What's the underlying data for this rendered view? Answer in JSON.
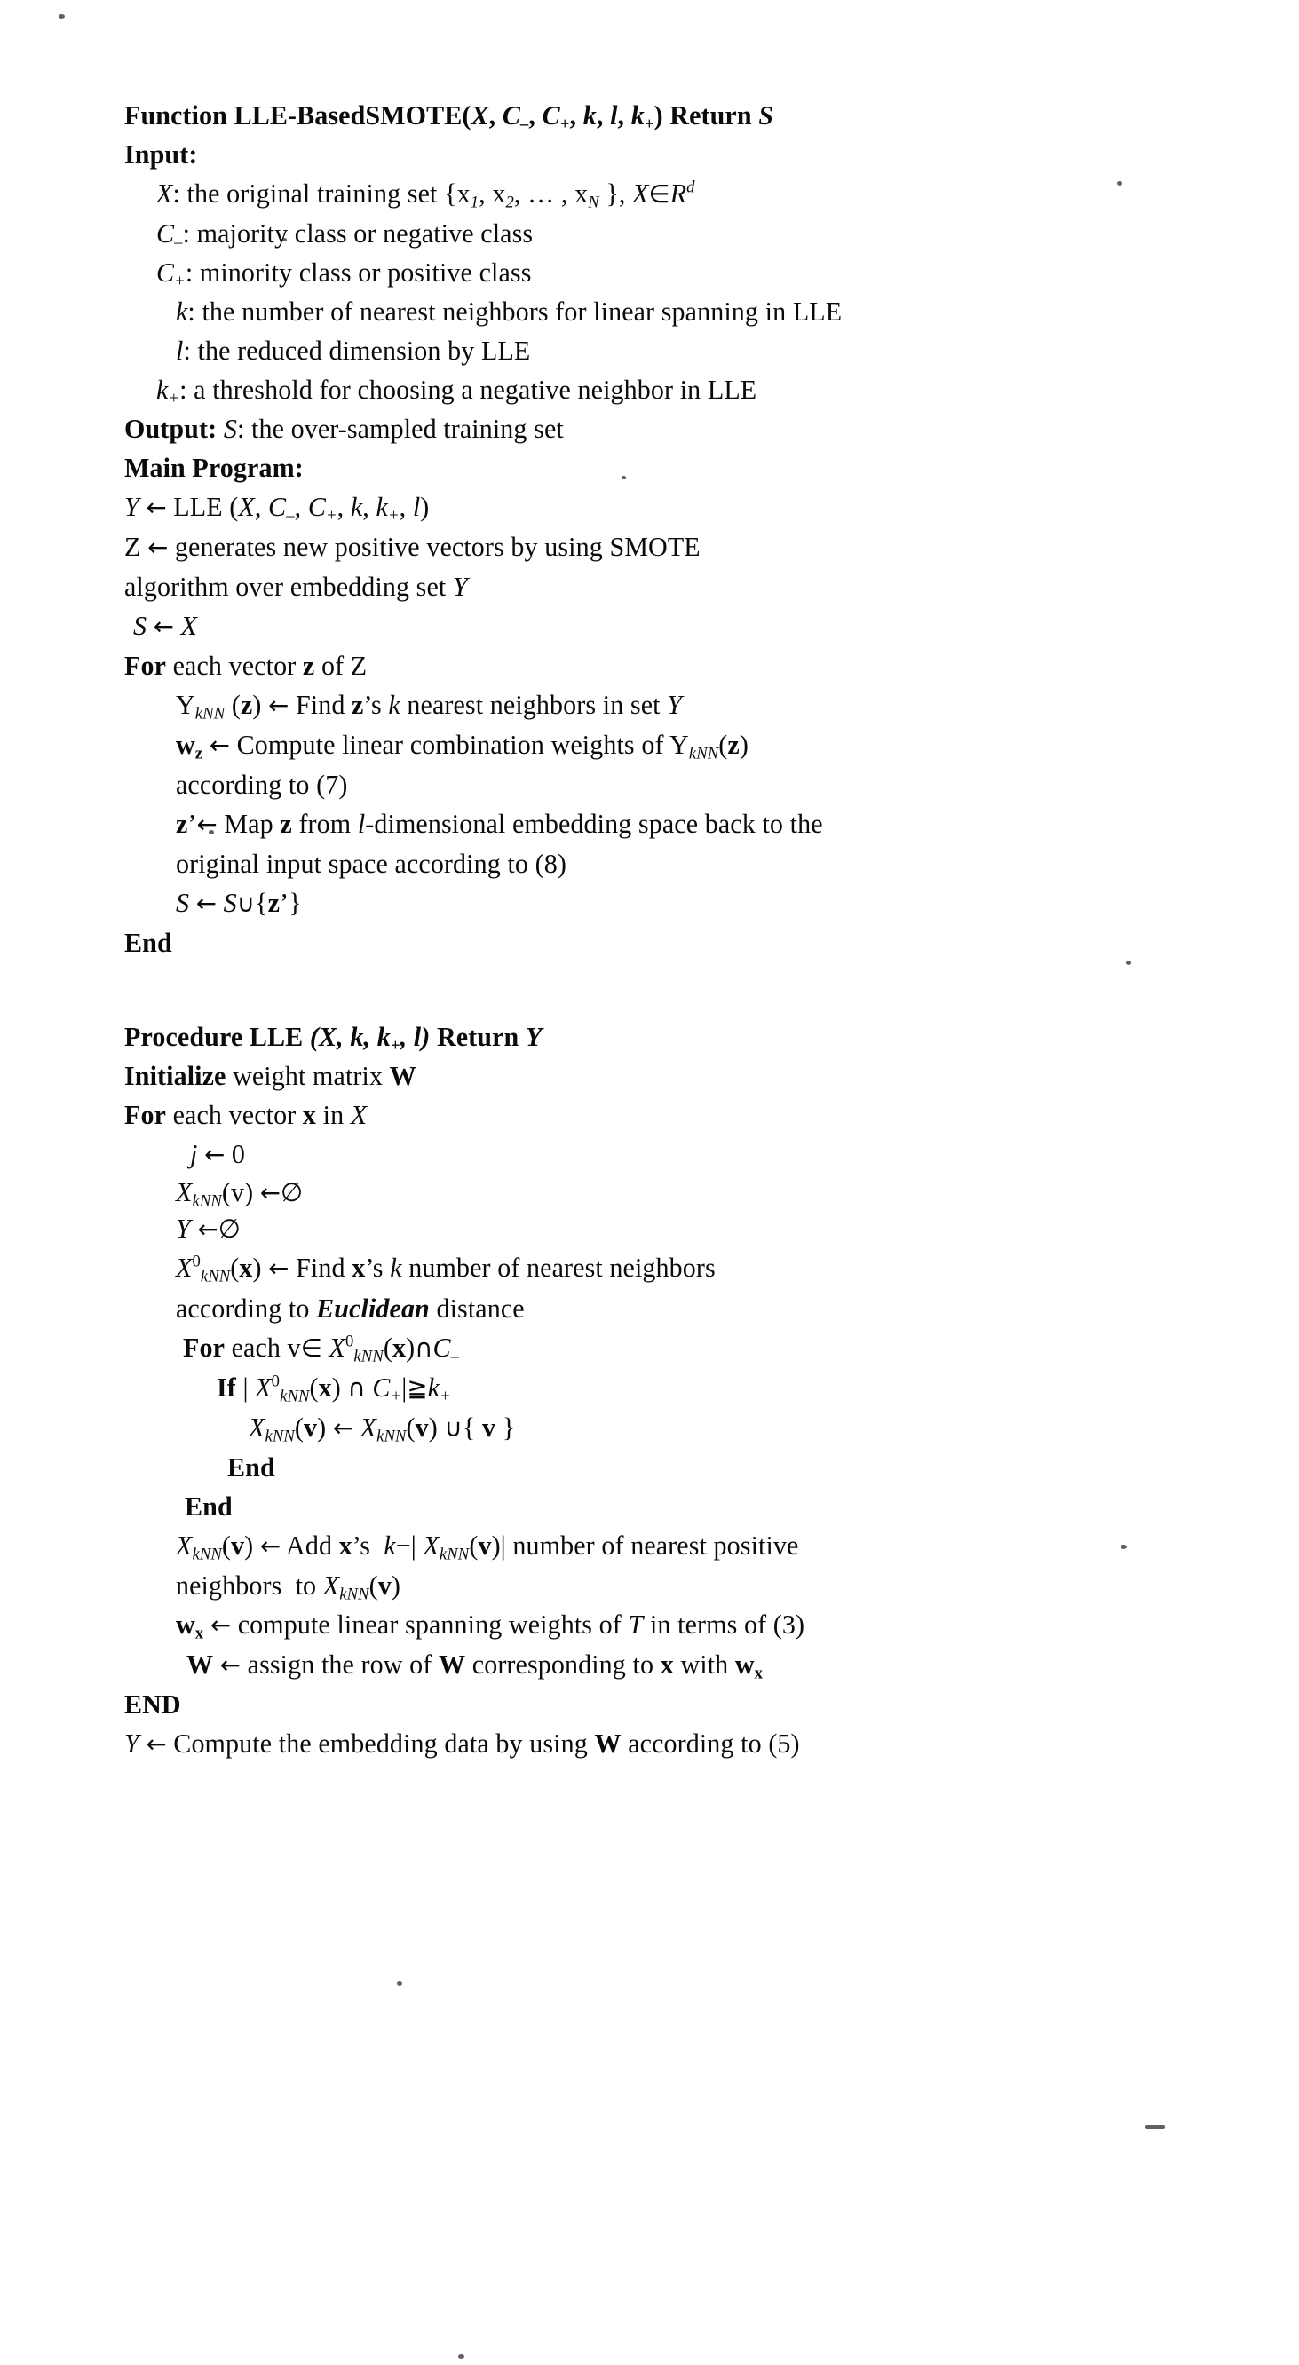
{
  "document": {
    "kind": "scanned-pseudocode-figure",
    "function_block": {
      "header": "Function LLE-BasedSMOTE(X, C₋, C₊, k, l, k₊) Return S",
      "input_label": "Input:",
      "inputs": [
        "X: the original training set {x₁, x₂, … , x_N }, X∈R^d",
        "C₋: majority class or negative class",
        "C₊: minority class or positive class",
        "k: the number of nearest neighbors for linear spanning in LLE",
        "l: the reduced dimension by LLE",
        "k₊: a threshold for choosing a negative neighbor in LLE"
      ],
      "output_line": "Output: S: the over-sampled training set",
      "main_label": "Main Program:",
      "main_lines": [
        "Y ← LLE (X, C₋, C₊, k, k₊, l)",
        "Z ← generates new positive vectors by using SMOTE",
        "algorithm over embedding set Y",
        "S ← X",
        "For each vector z of Z",
        "Y_kNN (z) ← Find z’s k nearest neighbors in set Y",
        "w_z ← Compute linear combination weights of Y_kNN(z)",
        "according to (7)",
        "z’← Map z from l-dimensional embedding space back to the",
        "original input space according to (8)",
        "S ← S∪{z’}",
        "End"
      ]
    },
    "procedure_block": {
      "header": "Procedure LLE (X, k, k₊, l) Return Y",
      "lines": [
        "Initialize weight matrix W",
        "For each vector x in X",
        "j ← 0",
        "X_kNN(v) ←∅",
        "Y ←∅",
        "X⁰_kNN(x) ← Find x’s k number of nearest neighbors",
        "according to Euclidean distance",
        "For each v∈ X⁰_kNN (x)∩C₋",
        "If | X⁰_kNN(x) ∩ C₊|≧k₊",
        "X_kNN(v) ← X_kNN(v) ∪{ v }",
        "End",
        "End",
        "X_kNN(v) ← Add x’s  k−| X_kNN(v)| number of nearest positive",
        "neighbors  to X_kNN(v)",
        "w_x ← compute linear spanning weights of T in terms of (3)",
        "W ← assign the row of W corresponding to x with w_x",
        "END",
        "Y ← Compute the embedding data by using W according to (5)"
      ]
    }
  }
}
